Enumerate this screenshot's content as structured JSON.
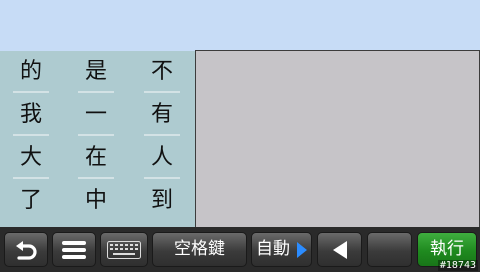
{
  "candidates": {
    "rows": [
      [
        "的",
        "是",
        "不"
      ],
      [
        "我",
        "一",
        "有"
      ],
      [
        "大",
        "在",
        "人"
      ],
      [
        "了",
        "中",
        "到"
      ]
    ]
  },
  "toolbar": {
    "back_icon": "undo-icon",
    "menu_icon": "menu-icon",
    "keyboard_icon": "keyboard-icon",
    "space_label": "空格鍵",
    "auto_label": "自動",
    "left_icon": "left-triangle-icon",
    "run_label": "執行"
  },
  "watermark": "#18743",
  "colors": {
    "accent_blue": "#2b8cff",
    "run_green": "#1f8a1f"
  }
}
